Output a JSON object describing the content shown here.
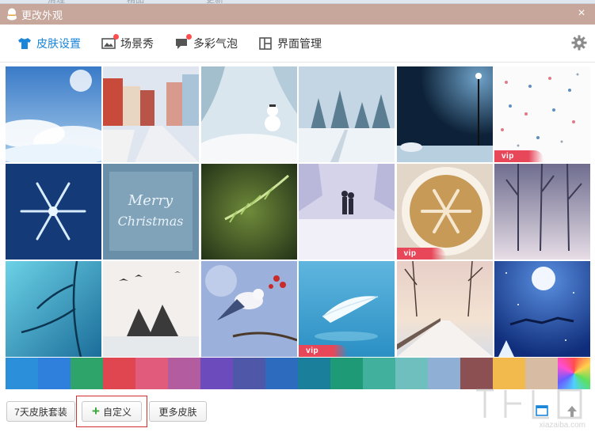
{
  "top_strip": [
    "清理",
    "精品",
    "更新"
  ],
  "window": {
    "title": "更改外观",
    "close_glyph": "×"
  },
  "tabs": [
    {
      "label": "皮肤设置",
      "icon": "tshirt-icon",
      "active": true
    },
    {
      "label": "场景秀",
      "icon": "picture-icon",
      "badge": true
    },
    {
      "label": "多彩气泡",
      "icon": "chat-bubble-icon",
      "badge": true
    },
    {
      "label": "界面管理",
      "icon": "layout-icon"
    }
  ],
  "skins": [
    {
      "name": "sky-clouds",
      "vip": false
    },
    {
      "name": "snowy-street",
      "vip": false
    },
    {
      "name": "snowman",
      "vip": false
    },
    {
      "name": "snowy-forest",
      "vip": false
    },
    {
      "name": "night-streetlamp",
      "vip": false
    },
    {
      "name": "snowflake-pattern",
      "vip": true
    },
    {
      "name": "blue-snowflake",
      "vip": false
    },
    {
      "name": "merry-christmas",
      "vip": false
    },
    {
      "name": "pine-branch",
      "vip": false
    },
    {
      "name": "couple-in-snow",
      "vip": false
    },
    {
      "name": "latte-art",
      "vip": true
    },
    {
      "name": "misty-trees",
      "vip": false
    },
    {
      "name": "blue-branches",
      "vip": false
    },
    {
      "name": "birds-over-lake",
      "vip": false
    },
    {
      "name": "bird-on-branch",
      "vip": false
    },
    {
      "name": "feather",
      "vip": true
    },
    {
      "name": "winter-boardwalk",
      "vip": false
    },
    {
      "name": "moon-reindeer",
      "vip": false
    }
  ],
  "vip_label": "vip",
  "colors": [
    "#2b8fd9",
    "#2f7fdc",
    "#2ea46a",
    "#e0464f",
    "#e05b7c",
    "#b35ca0",
    "#6c4bbd",
    "#4f58a8",
    "#2c6bbd",
    "#1a7f9a",
    "#1f9a76",
    "#41b09c",
    "#6fbfbf",
    "#8fb0d4",
    "#8c4f52",
    "#f2b94d",
    "#d8bba3",
    "rainbow"
  ],
  "buttons": {
    "suit": "7天皮肤套装",
    "custom": "自定义",
    "more": "更多皮肤"
  },
  "watermark": "xiazaiba.com"
}
